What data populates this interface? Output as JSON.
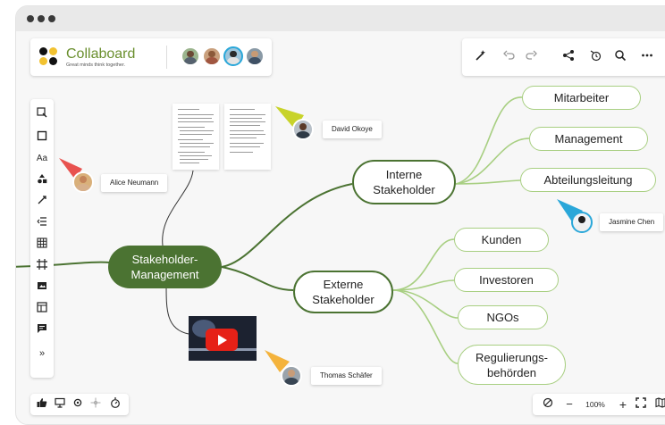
{
  "app": {
    "name": "Collaboard",
    "tagline": "Great minds think together."
  },
  "collaborators": [
    "avatar-1",
    "avatar-2",
    "avatar-3",
    "avatar-4"
  ],
  "toolbar_top": [
    "magic-wand-icon",
    "undo-icon",
    "redo-icon",
    "share-icon",
    "timer-icon",
    "search-icon",
    "more-icon"
  ],
  "toolbar_left": {
    "items": [
      "select-icon",
      "sticky-note-icon",
      "text-tool",
      "shapes-icon",
      "connector-icon",
      "list-icon",
      "table-icon",
      "frame-icon",
      "media-icon",
      "template-icon",
      "comment-icon",
      "expand-icon"
    ],
    "text_label": "Aa",
    "expand_label": "»"
  },
  "bottom_left": [
    "like-icon",
    "presentation-icon",
    "settings-icon",
    "move-icon",
    "timer-icon"
  ],
  "bottom_right": {
    "zoom_value": "100%",
    "minus": "−",
    "plus": "+"
  },
  "mindmap": {
    "root": "Stakeholder-\nManagement",
    "internal": "Interne\nStakeholder",
    "external": "Externe\nStakeholder",
    "internal_children": [
      "Mitarbeiter",
      "Management",
      "Abteilungsleitung"
    ],
    "external_children": [
      "Kunden",
      "Investoren",
      "NGOs",
      "Regulierungs-\nbehörden"
    ]
  },
  "users": {
    "alice": "Alice Neumann",
    "david": "David Okoye",
    "jasmine": "Jasmine Chen",
    "thomas": "Thomas Schäfer"
  },
  "colors": {
    "brand_green": "#6a8f2e",
    "root_fill": "#4b7332",
    "leaf_border": "#a8cf82",
    "alice_pointer": "#e8524f",
    "david_pointer": "#c8d32a",
    "jasmine_pointer": "#2aa7d9",
    "thomas_pointer": "#f4b33c"
  }
}
